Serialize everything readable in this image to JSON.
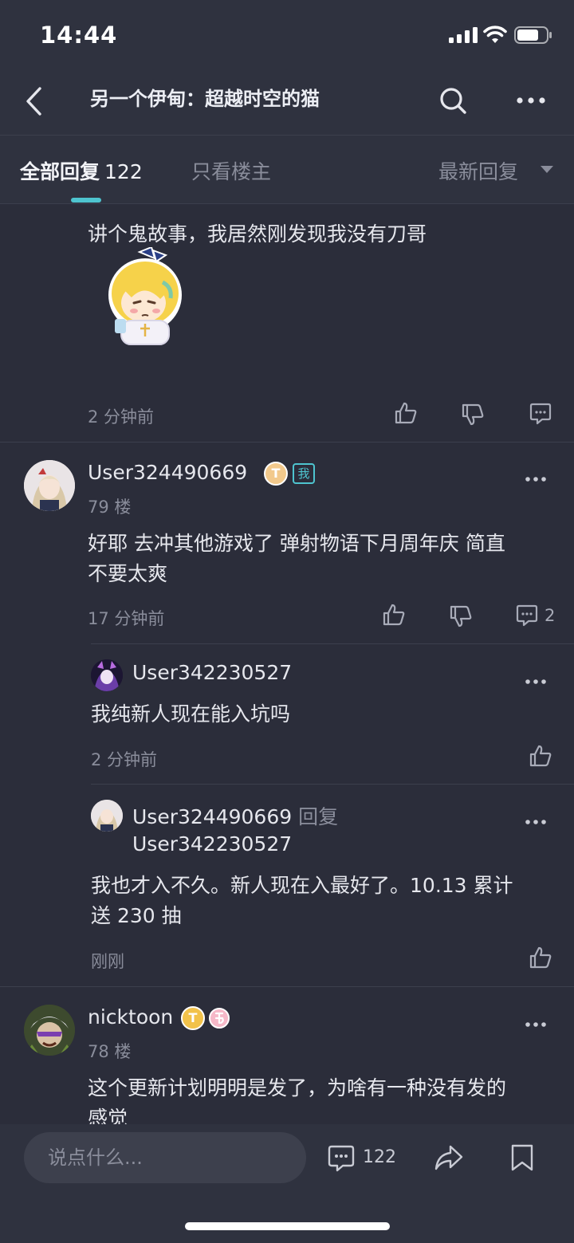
{
  "status_bar": {
    "time": "14:44"
  },
  "header": {
    "title": "另一个伊甸：超越时空的猫"
  },
  "tabs": {
    "all_label": "全部回复",
    "all_count": "122",
    "owner_label": "只看楼主",
    "sort_label": "最新回复"
  },
  "post_top": {
    "text": "讲个鬼故事，我居然刚发现我没有刀哥",
    "time": "2 分钟前"
  },
  "post_79": {
    "username": "User324490669",
    "badge_level": "T",
    "badge_me": "我",
    "floor": "79 楼",
    "text_line1": "好耶 去冲其他游戏了 弹射物语下月周年庆 简直",
    "text_line2": "不要太爽",
    "time": "17 分钟前",
    "reply_count": "2",
    "replies": [
      {
        "username": "User342230527",
        "text": "我纯新人现在能入坑吗",
        "time": "2 分钟前"
      },
      {
        "username": "User324490669",
        "reply_word": "回复",
        "reply_to": "User342230527",
        "text_line1": "我也才入不久。新人现在入最好了。10.13 累计",
        "text_line2": "送 230 抽",
        "time": "刚刚"
      }
    ]
  },
  "post_78": {
    "username": "nicktoon",
    "badge_level": "T",
    "floor": "78 楼",
    "text_line1": "这个更新计划明明是发了，为啥有一种没有发的",
    "text_line2": "感觉"
  },
  "bottom_bar": {
    "input_placeholder": "说点什么...",
    "comment_count": "122"
  },
  "colors": {
    "background": "#2b2d3a",
    "accent": "#4ec4cf",
    "muted_text": "#8a8d9b"
  }
}
